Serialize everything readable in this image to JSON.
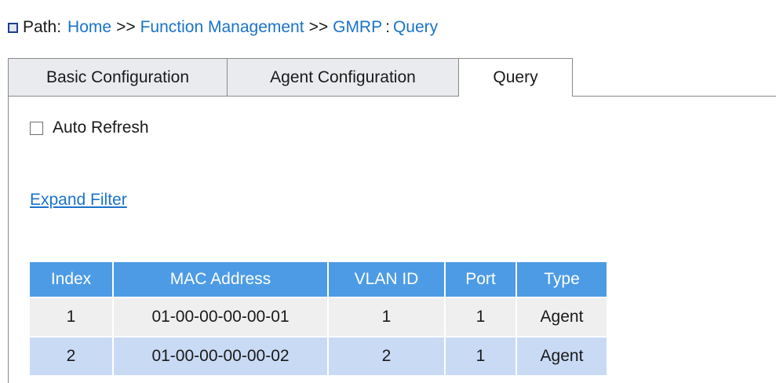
{
  "breadcrumb": {
    "label": "Path:",
    "items": [
      "Home",
      "Function Management",
      "GMRP",
      "Query"
    ],
    "separator": ">>",
    "last_separator": ":"
  },
  "tabs": [
    {
      "label": "Basic Configuration",
      "active": false
    },
    {
      "label": "Agent Configuration",
      "active": false
    },
    {
      "label": "Query",
      "active": true
    }
  ],
  "auto_refresh": {
    "label": "Auto Refresh",
    "checked": false
  },
  "expand_filter": {
    "label": "Expand Filter"
  },
  "table": {
    "columns": [
      "Index",
      "MAC Address",
      "VLAN ID",
      "Port",
      "Type"
    ],
    "rows": [
      [
        "1",
        "01-00-00-00-00-01",
        "1",
        "1",
        "Agent"
      ],
      [
        "2",
        "01-00-00-00-00-02",
        "2",
        "1",
        "Agent"
      ]
    ]
  },
  "colors": {
    "link": "#1a73c9",
    "header_bg": "#4d9be5",
    "row_odd_bg": "#efefef",
    "row_even_bg": "#c9daf5"
  }
}
